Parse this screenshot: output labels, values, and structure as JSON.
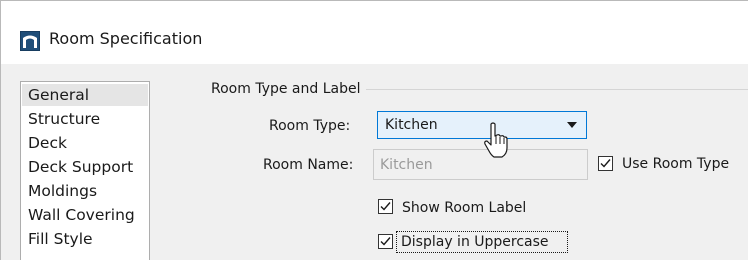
{
  "window": {
    "title": "Room Specification",
    "app_icon": "chief-architect-icon"
  },
  "nav": {
    "items": [
      {
        "label": "General",
        "selected": true
      },
      {
        "label": "Structure",
        "selected": false
      },
      {
        "label": "Deck",
        "selected": false
      },
      {
        "label": "Deck Support",
        "selected": false
      },
      {
        "label": "Moldings",
        "selected": false
      },
      {
        "label": "Wall Covering",
        "selected": false
      },
      {
        "label": "Fill Style",
        "selected": false
      }
    ]
  },
  "general": {
    "group_label": "Room Type and Label",
    "room_type_label": "Room Type:",
    "room_type_value": "Kitchen",
    "room_name_label": "Room Name:",
    "room_name_value": "Kitchen",
    "use_room_type_label": "Use Room Type",
    "use_room_type_checked": true,
    "show_room_label_label": "Show Room Label",
    "show_room_label_checked": true,
    "display_uppercase_label": "Display in Uppercase",
    "display_uppercase_checked": true
  },
  "colors": {
    "combo_border": "#0078d7",
    "combo_fill": "#e5f1fb",
    "selected_nav": "#e5e5e5"
  }
}
